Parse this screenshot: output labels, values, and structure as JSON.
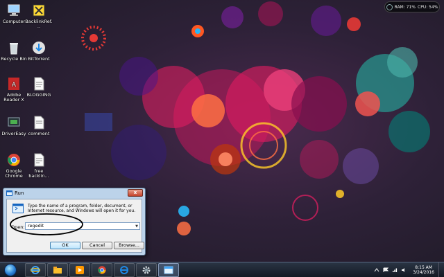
{
  "desktop": {
    "icons": [
      {
        "label": "Computer"
      },
      {
        "label": "BacklinkRef..."
      },
      {
        "label": "Recycle Bin"
      },
      {
        "label": "BitTorrent"
      },
      {
        "label": "Adobe Reader X"
      },
      {
        "label": "BLOGGING"
      },
      {
        "label": "DriverEasy"
      },
      {
        "label": "comment"
      },
      {
        "label": "Google Chrome"
      },
      {
        "label": "free backlin..."
      }
    ]
  },
  "gadget": {
    "ram": "RAM: 71%",
    "cpu": "CPU: 54%"
  },
  "run_dialog": {
    "title": "Run",
    "close_label": "x",
    "description": "Type the name of a program, folder, document, or Internet resource, and Windows will open it for you.",
    "open_label": "Open:",
    "open_value": "regedit",
    "ok_label": "OK",
    "cancel_label": "Cancel",
    "browse_label": "Browse..."
  },
  "taskbar": {
    "items": [
      {
        "icon": "internet-explorer-icon"
      },
      {
        "icon": "windows-explorer-icon"
      },
      {
        "icon": "media-player-icon"
      },
      {
        "icon": "google-chrome-icon"
      },
      {
        "icon": "internet-explorer-icon"
      },
      {
        "icon": "settings-gear-icon"
      },
      {
        "icon": "run-window-icon"
      }
    ],
    "time": "8:15 AM",
    "date": "3/24/2016"
  }
}
